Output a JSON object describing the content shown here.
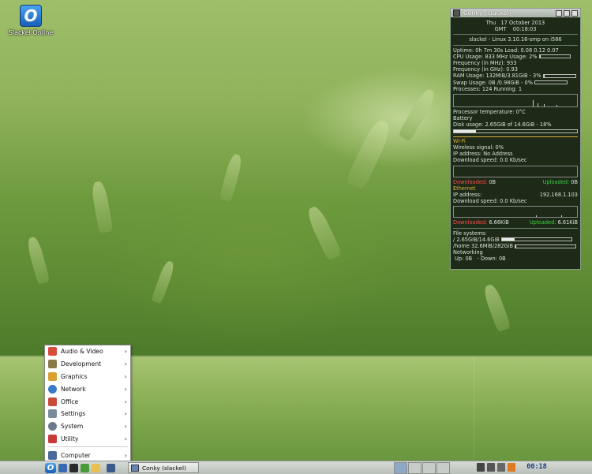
{
  "desktop": {
    "icons": [
      {
        "label": "Slackel Online",
        "glyph": "O"
      }
    ]
  },
  "conky": {
    "title": "Conky (slackel)",
    "day": "Thu",
    "date": "17 October 2013",
    "tz": "GMT",
    "time": "00:18:03",
    "system_line": "slackel - Linux 3.10.16-smp on i586",
    "uptime": "Uptime: 0h 7m 30s Load: 0.08 0.12 0.07",
    "cpu": "CPU Usage:  833 MHz  Usage: 2%",
    "freq_mhz": "Frequency (in MHz): 933",
    "freq_ghz": "Frequency (in GHz): 0.93",
    "ram": "RAM Usage: 132MiB/3.81GiB - 3%",
    "ram_pct": 3,
    "swap": "Swap Usage: 0B  /0.98GiB - 0%",
    "swap_pct": 0,
    "processes": "Processes: 124  Running: 1",
    "temp": "Processor temperature: 0°C",
    "battery": "Battery",
    "disk": "Disk usage: 2.65GiB of 14.6GiB - 18%",
    "disk_pct": 18,
    "wifi_title": "Wi-Fi",
    "wifi_signal": "Wireless signal: 0%",
    "wifi_ip": "IP address: No Address",
    "wifi_dl": "Download speed: 0.0 Kb/sec",
    "wifi_downloaded_label": "Downloaded:",
    "wifi_downloaded": "0B",
    "wifi_uploaded_label": "Uploaded:",
    "wifi_uploaded": "0B",
    "eth_title": "Ethernet",
    "eth_ip_label": "IP address:",
    "eth_ip": "192.168.1.103",
    "eth_dl": "Download speed: 0.0 Kb/sec",
    "eth_downloaded_label": "Downloaded:",
    "eth_downloaded": "6.66KiB",
    "eth_uploaded_label": "Uploaded:",
    "eth_uploaded": "6.61KiB",
    "fs_title": "File systems:",
    "fs_root": "/ 2.65GiB/14.6GiB",
    "fs_root_pct": 18,
    "fs_home": "/home 32.6MiB/282GiB",
    "fs_home_pct": 1,
    "net_title": "Networking",
    "net_up_label": "Up:",
    "net_up": "0B",
    "net_down_label": "- Down:",
    "net_down": "0B"
  },
  "menu": {
    "items": [
      {
        "label": "Audio & Video",
        "icon": "audio-video-icon",
        "color": "#d84a3a"
      },
      {
        "label": "Development",
        "icon": "development-icon",
        "color": "#8a7a4a"
      },
      {
        "label": "Graphics",
        "icon": "graphics-icon",
        "color": "#d8a030"
      },
      {
        "label": "Network",
        "icon": "network-icon",
        "color": "#3a7ac8"
      },
      {
        "label": "Office",
        "icon": "office-icon",
        "color": "#c84a3a"
      },
      {
        "label": "Settings",
        "icon": "settings-icon",
        "color": "#7a8a9a"
      },
      {
        "label": "System",
        "icon": "system-icon",
        "color": "#6a7a8a"
      },
      {
        "label": "Utility",
        "icon": "utility-icon",
        "color": "#c83a3a"
      }
    ],
    "computer": "Computer"
  },
  "panel": {
    "task_label": "Conky (slackel)",
    "clock": "00:18",
    "desktops": 4
  }
}
